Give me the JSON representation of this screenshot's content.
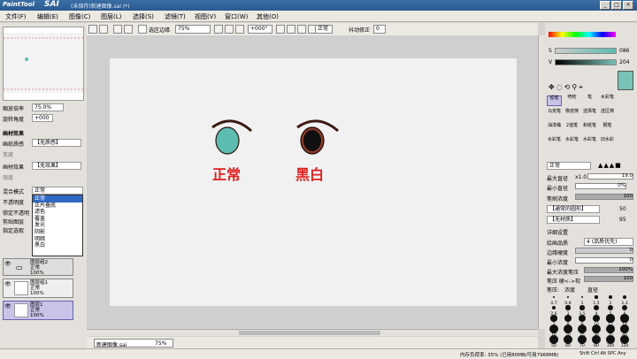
{
  "app": {
    "logo": "PaintTool",
    "name": "SAI",
    "document_title": "(未保存)新建图像.sai (*)",
    "window_buttons": [
      "_",
      "□",
      "×"
    ]
  },
  "menu": [
    "文件(F)",
    "编辑(E)",
    "图像(C)",
    "图层(L)",
    "选择(S)",
    "滤镜(T)",
    "视图(V)",
    "窗口(W)",
    "其他(O)"
  ],
  "toolbar": {
    "selection_edge_label": "选区边缘",
    "zoom": "75%",
    "angle": "+000°",
    "mode": "正常",
    "stabilizer_label": "抖动修正",
    "stabilizer_value": "0"
  },
  "navigator": {
    "zoom_label": "缩放倍率",
    "zoom_value": "75.0%",
    "rotate_label": "旋转角度",
    "rotate_value": "+000"
  },
  "paper_effects": {
    "section": "画材效果",
    "texture_label": "画纸质感",
    "texture_value": "【无质感】",
    "effect_label": "画材效果",
    "effect_value": "【无效果】",
    "width_label": "宽度",
    "strength_label": "强度"
  },
  "layer_props": {
    "blend_label": "混合模式",
    "blend_value": "正常",
    "opacity_label": "不透明度",
    "check1": "锁定不透明",
    "check2": "剪贴图层",
    "check3": "指定选取"
  },
  "blend_options": [
    "正常",
    "正片叠底",
    "滤色",
    "覆盖",
    "发光",
    "阴影",
    "明暗",
    "黑白"
  ],
  "layers": [
    {
      "name": "图层组2",
      "mode": "正常",
      "opacity": "100%"
    },
    {
      "name": "图层组1",
      "mode": "正常",
      "opacity": "100%"
    },
    {
      "name": "图层1",
      "mode": "正常",
      "opacity": "100%"
    }
  ],
  "canvas": {
    "label_left": "正常",
    "label_right": "黑白",
    "label_color": "#e02020",
    "iris_left_color": "#5dbcb0",
    "iris_right_color": "#8a3a2a"
  },
  "tab": {
    "name": "新建图像.sai",
    "zoom": "75%"
  },
  "status": {
    "memory": "内存负荷率: 35% (已用80MB/可用7968MB)",
    "keys": "Shift Ctrl Alt SPC Any"
  },
  "color": {
    "S_label": "S",
    "S_value": "086",
    "V_label": "V",
    "V_value": "204",
    "current": "#79c2b7"
  },
  "tools": [
    "铅笔",
    "喷枪",
    "笔",
    "水彩笔",
    "马克笔",
    "橡皮擦",
    "选择笔",
    "选区擦",
    "油漆桶",
    "2值笔",
    "和纸笔",
    "钢笔",
    "水彩笔",
    "水彩笔",
    "水彩笔",
    "旧水彩"
  ],
  "brush": {
    "mode": "正常",
    "max_size_label": "最大直径",
    "max_size_mult": "x1.0",
    "max_size": "19.0",
    "min_size_label": "最小直径",
    "min_size": "0%",
    "density_label": "笔刷浓度",
    "density": "100",
    "shape": "【通常的圆形】",
    "shape_value": "50",
    "texture": "【无材质】",
    "texture_value": "95",
    "detail_label": "详细设置",
    "quality_label": "绘画品质",
    "quality_value": "4 (品质优先)",
    "edge_label": "边缘硬度",
    "edge_value": "0",
    "min_density_label": "最小浓度",
    "min_density_value": "0",
    "max_pressure_label": "最大浓度笔压",
    "max_pressure_value": "100%",
    "pressure_label": "笔压 硬<->软",
    "pressure_value": "100",
    "pressure2_label": "笔压:",
    "pressure_density": "浓度",
    "pressure_size": "直径"
  },
  "brush_sizes": [
    "0.7",
    "0.8",
    "1",
    "1.5",
    "2",
    "2.3",
    "2.6",
    "3",
    "3.5",
    "4",
    "5",
    "6",
    "7",
    "8",
    "9",
    "10",
    "12",
    "14",
    "16",
    "20",
    "25",
    "30",
    "35",
    "40",
    "50",
    "60",
    "70",
    "80",
    "100",
    "120"
  ]
}
